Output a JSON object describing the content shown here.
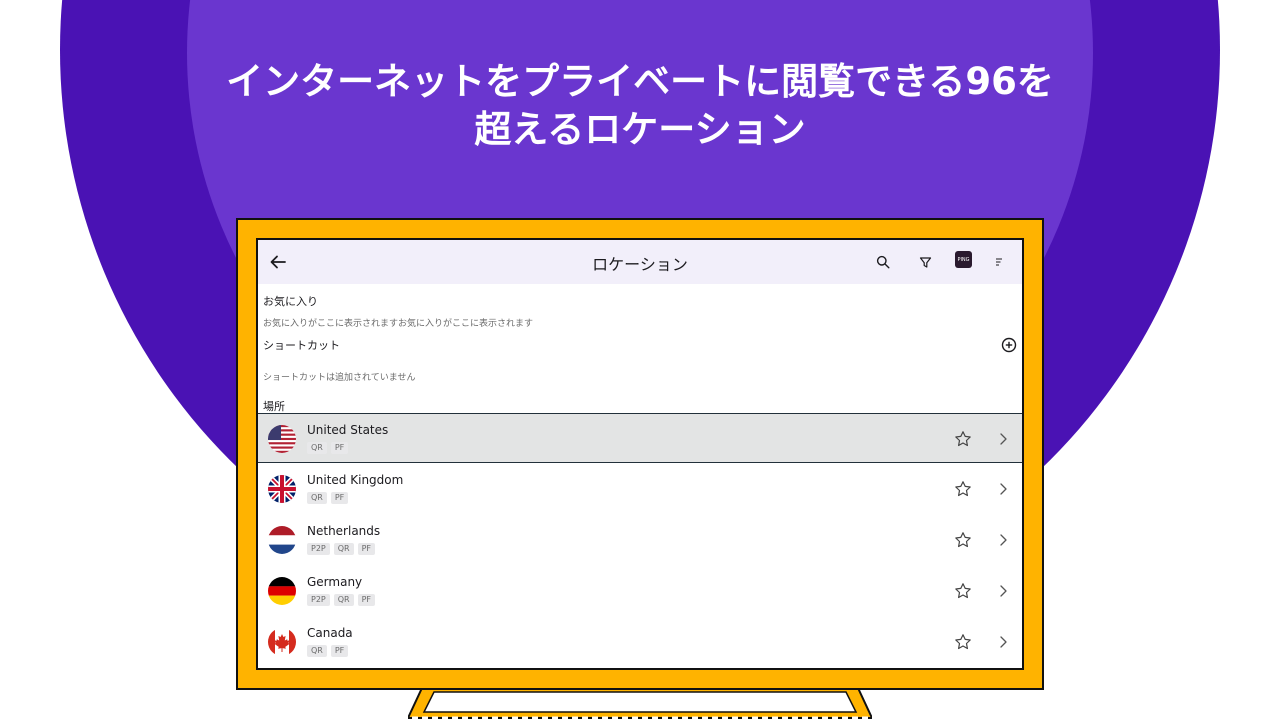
{
  "headline": {
    "line1": "インターネットをプライベートに閲覧できる96を",
    "line2": "超えるロケーション"
  },
  "colors": {
    "outer_circle": "#4a12b4",
    "inner_circle": "#6a36cf",
    "monitor_frame": "#ffb300",
    "appbar_bg": "#f2effa",
    "selected_row_bg": "#e3e4e4"
  },
  "app": {
    "title": "ロケーション",
    "back_icon": "arrow-left-icon",
    "toolbar_icons": [
      "search-icon",
      "filter-icon",
      "ping-icon",
      "sort-menu-icon"
    ],
    "ping_label": "PING"
  },
  "favorites": {
    "title": "お気に入り",
    "empty_text": "お気に入りがここに表示されますお気に入りがここに表示されます"
  },
  "shortcuts": {
    "title": "ショートカット",
    "empty_text": "ショートカットは追加されていません",
    "add_icon": "plus-circle-icon"
  },
  "locations": {
    "title": "場所",
    "items": [
      {
        "name": "United States",
        "tags": [
          "QR",
          "PF"
        ],
        "flag": "us",
        "selected": true
      },
      {
        "name": "United Kingdom",
        "tags": [
          "QR",
          "PF"
        ],
        "flag": "gb",
        "selected": false
      },
      {
        "name": "Netherlands",
        "tags": [
          "P2P",
          "QR",
          "PF"
        ],
        "flag": "nl",
        "selected": false
      },
      {
        "name": "Germany",
        "tags": [
          "P2P",
          "QR",
          "PF"
        ],
        "flag": "de",
        "selected": false
      },
      {
        "name": "Canada",
        "tags": [
          "QR",
          "PF"
        ],
        "flag": "ca",
        "selected": false
      }
    ]
  }
}
